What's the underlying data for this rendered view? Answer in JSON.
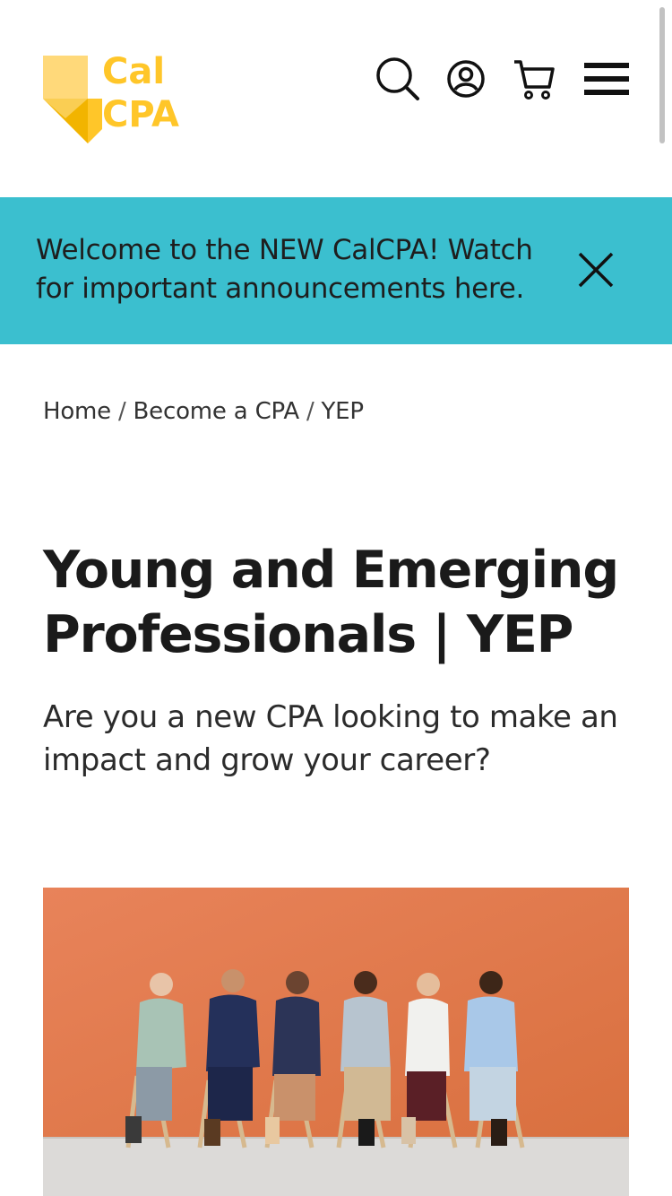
{
  "header": {
    "logo": {
      "line1": "Cal",
      "line2": "CPA",
      "brand_color": "#ffc629"
    },
    "icons": [
      "search-icon",
      "account-icon",
      "cart-icon",
      "menu-icon"
    ]
  },
  "banner": {
    "message": "Welcome to the NEW CalCPA! Watch for important announcements here.",
    "background": "#3bbfcf",
    "close_icon": "close-icon"
  },
  "breadcrumb": {
    "items": [
      "Home",
      "Become a CPA",
      "YEP"
    ],
    "separator": "/"
  },
  "main": {
    "title": "Young and Emerging Professionals | YEP",
    "subtitle": "Are you a new CPA looking to make an impact and grow your career?"
  },
  "hero_image": {
    "background": "#e07a4c"
  }
}
